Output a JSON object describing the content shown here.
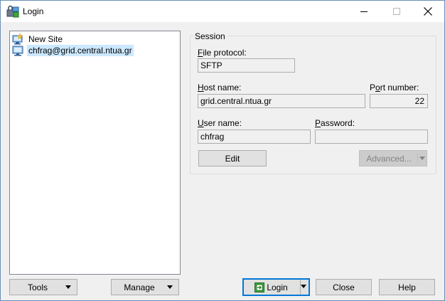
{
  "window": {
    "title": "Login",
    "icon": "winscp-login-icon"
  },
  "tree": {
    "items": [
      {
        "label": "New Site",
        "icon": "new-site-icon",
        "selected": false
      },
      {
        "label": "chfrag@grid.central.ntua.gr",
        "icon": "site-computer-icon",
        "selected": true
      }
    ]
  },
  "session": {
    "legend": "Session",
    "file_protocol": {
      "label_prefix": "F",
      "label_rest": "ile protocol:",
      "value": "SFTP"
    },
    "host_name": {
      "label_prefix": "H",
      "label_rest": "ost name:",
      "value": "grid.central.ntua.gr"
    },
    "port_number": {
      "label_prefix": "P",
      "label_mid": "o",
      "label_rest": "rt number:",
      "value": "22"
    },
    "user_name": {
      "label_prefix": "U",
      "label_rest": "ser name:",
      "value": "chfrag"
    },
    "password": {
      "label_prefix": "P",
      "label_rest": "assword:",
      "value": ""
    },
    "edit_label": "Edit",
    "advanced_label": "Advanced..."
  },
  "bottom": {
    "tools_label": "Tools",
    "manage_label": "Manage",
    "login_label": "Login",
    "close_label": "Close",
    "help_label": "Help"
  },
  "colors": {
    "selection": "#cce8ff",
    "accent": "#0078d7",
    "button": "#e1e1e1"
  }
}
